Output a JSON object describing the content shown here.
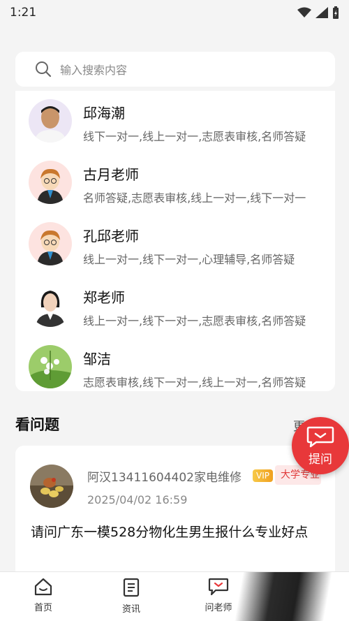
{
  "status_bar": {
    "time": "1:21",
    "icons": [
      "wifi-icon",
      "signal-icon",
      "battery-icon"
    ]
  },
  "search": {
    "placeholder": "输入搜索内容"
  },
  "teachers": [
    {
      "name": "邱海潮",
      "tags": "线下一对一,线上一对一,志愿表审核,名师答疑"
    },
    {
      "name": "古月老师",
      "tags": "名师答疑,志愿表审核,线上一对一,线下一对一"
    },
    {
      "name": "孔邱老师",
      "tags": "线上一对一,线下一对一,心理辅导,名师答疑"
    },
    {
      "name": "郑老师",
      "tags": "线上一对一,线下一对一,志愿表审核,名师答疑"
    },
    {
      "name": "邹洁",
      "tags": "志愿表审核,线下一对一,线上一对一,名师答疑"
    }
  ],
  "questions_section": {
    "title": "看问题",
    "more": "更多"
  },
  "question": {
    "user": "阿汉13411604402家电维修",
    "vip": "VIP",
    "major": "大学专业",
    "time": "2025/04/02 16:59",
    "text": "请问广东一模528分物化生男生报什么专业好点"
  },
  "fab": {
    "label": "提问"
  },
  "bottom_nav": [
    {
      "label": "首页",
      "icon": "home-icon"
    },
    {
      "label": "资讯",
      "icon": "news-icon"
    },
    {
      "label": "问老师",
      "icon": "chat-icon"
    }
  ],
  "colors": {
    "accent": "#e8383a",
    "background": "#f4f4f4"
  }
}
